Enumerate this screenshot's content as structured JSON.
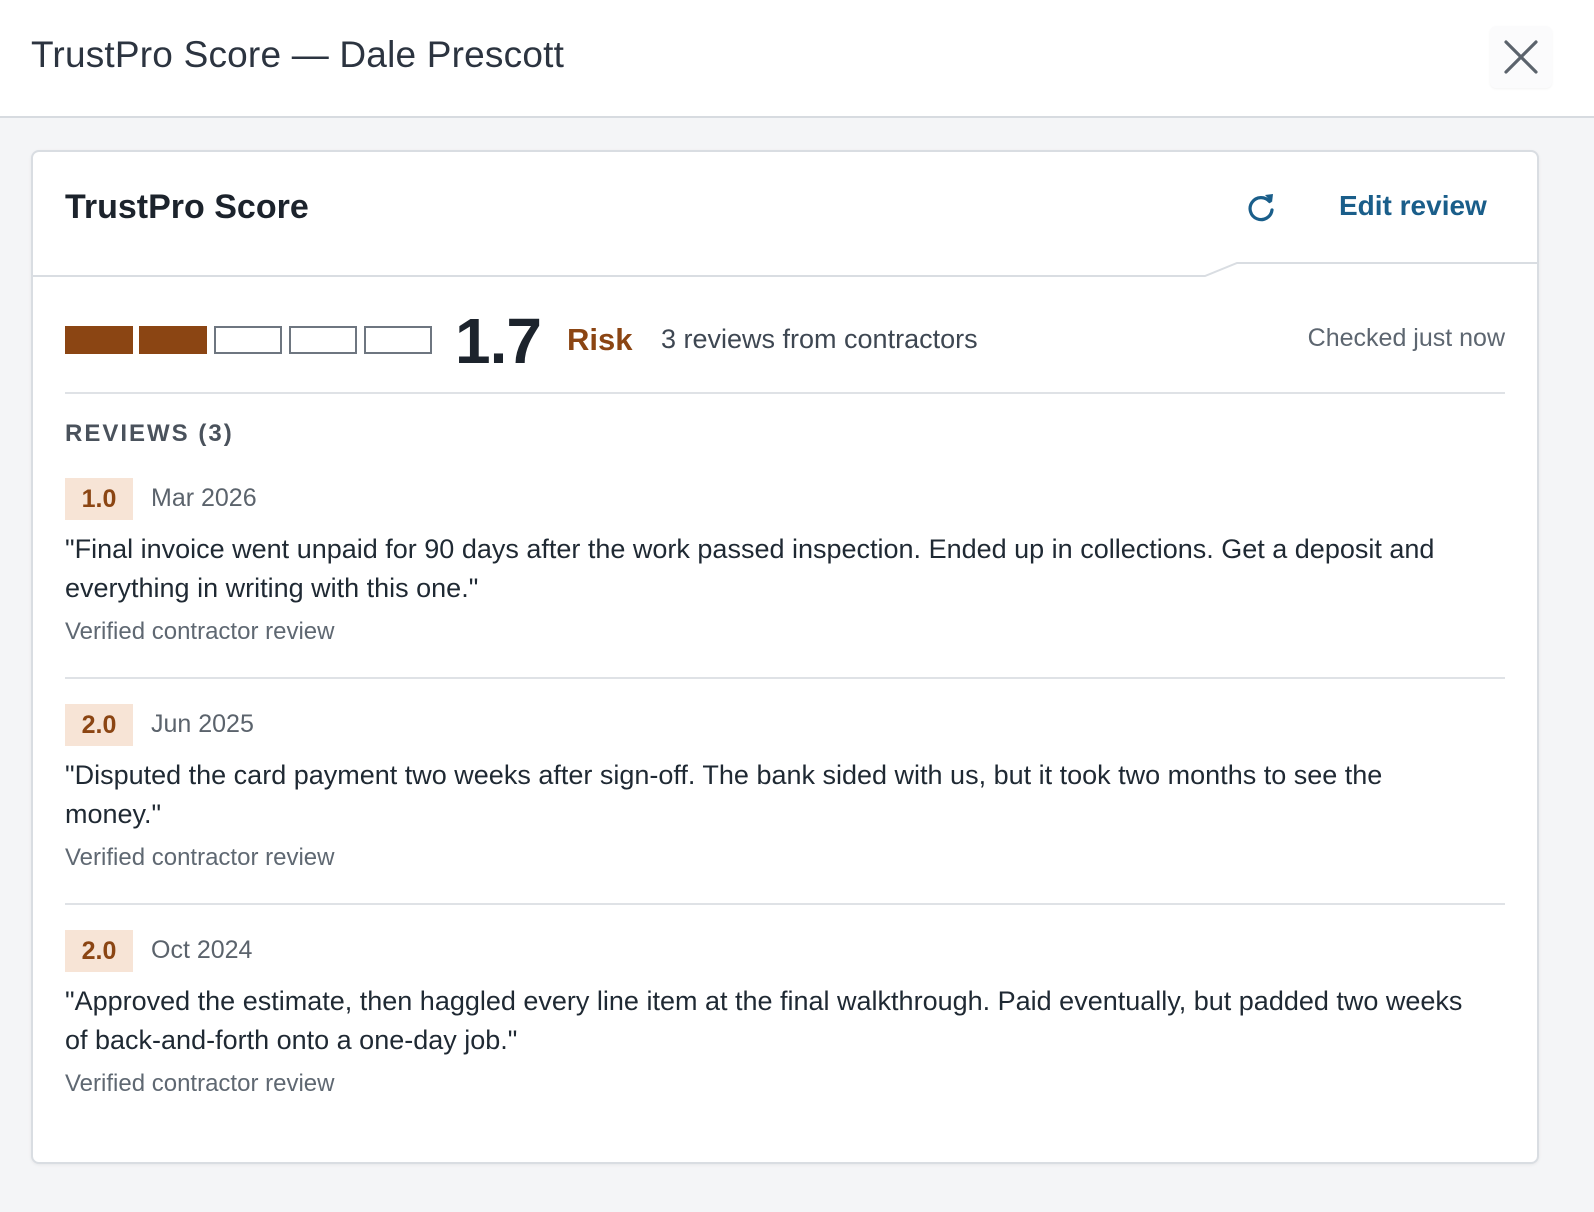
{
  "modal": {
    "title": "TrustPro Score — Dale Prescott",
    "close_icon": "close-icon"
  },
  "card": {
    "title": "TrustPro Score",
    "refresh_icon": "refresh-icon",
    "edit_label": "Edit review"
  },
  "score": {
    "value": "1.7",
    "out_of": 5,
    "band": "Risk",
    "review_count_text": "3 reviews from contractors",
    "checked_text": "Checked just now"
  },
  "reviews_section": {
    "label": "REVIEWS (3)",
    "items": [
      {
        "rating": "1.0",
        "date": "Mar 2026",
        "text": "\"Final invoice went unpaid for 90 days after the work passed inspection. Ended up in collections. Get a deposit and everything in writing with this one.\"",
        "source": "Verified contractor review"
      },
      {
        "rating": "2.0",
        "date": "Jun 2025",
        "text": "\"Disputed the card payment two weeks after sign-off. The bank sided with us, but it took two months to see the money.\"",
        "source": "Verified contractor review"
      },
      {
        "rating": "2.0",
        "date": "Oct 2024",
        "text": "\"Approved the estimate, then haggled every line item at the final walkthrough. Paid eventually, but padded two weeks of back-and-forth onto a one-day job.\"",
        "source": "Verified contractor review"
      }
    ]
  },
  "colors": {
    "risk": "#8b4513",
    "badge_bg": "#f7e4d6",
    "link": "#1a5e8a"
  }
}
